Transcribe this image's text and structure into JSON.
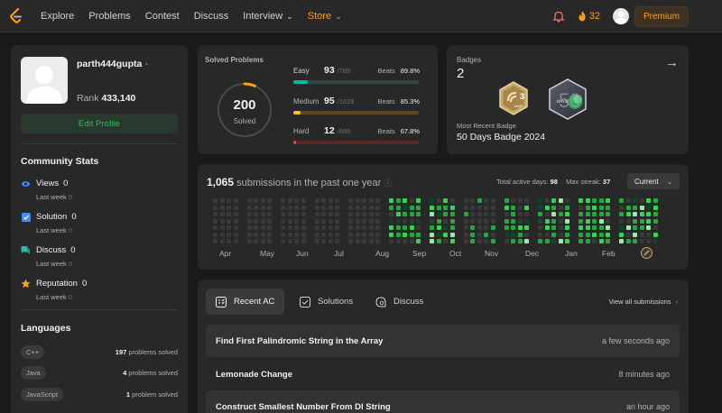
{
  "nav": {
    "links": [
      "Explore",
      "Problems",
      "Contest",
      "Discuss",
      "Interview",
      "Store"
    ],
    "streak": "32",
    "premium": "Premium"
  },
  "profile": {
    "username": "parth444gupta",
    "rank_label": "Rank",
    "rank_value": "433,140",
    "edit_label": "Edit Profile"
  },
  "community": {
    "title": "Community Stats",
    "items": [
      {
        "label": "Views",
        "value": "0",
        "sub": "Last week",
        "sub_value": "0"
      },
      {
        "label": "Solution",
        "value": "0",
        "sub": "Last week",
        "sub_value": "0"
      },
      {
        "label": "Discuss",
        "value": "0",
        "sub": "Last week",
        "sub_value": "0"
      },
      {
        "label": "Reputation",
        "value": "0",
        "sub": "Last week",
        "sub_value": "0"
      }
    ]
  },
  "languages": {
    "title": "Languages",
    "items": [
      {
        "name": "C++",
        "count": "197",
        "suffix": "problems solved"
      },
      {
        "name": "Java",
        "count": "4",
        "suffix": "problems solved"
      },
      {
        "name": "JavaScript",
        "count": "1",
        "suffix": "problem solved"
      }
    ]
  },
  "solved": {
    "title": "Solved Problems",
    "total": "200",
    "total_label": "Solved",
    "progress": 0.064,
    "beats_label": "Beats",
    "difficulties": [
      {
        "name": "Easy",
        "count": "93",
        "total": "/785",
        "beats": "89.8%",
        "fraction": 0.118,
        "color": "#00b8a3",
        "track": "#2a4a47"
      },
      {
        "name": "Medium",
        "count": "95",
        "total": "/1628",
        "beats": "85.3%",
        "fraction": 0.058,
        "color": "#ffc01e",
        "track": "#5a4a1f"
      },
      {
        "name": "Hard",
        "count": "12",
        "total": "/689",
        "beats": "67.8%",
        "fraction": 0.017,
        "color": "#ef4743",
        "track": "#5a2a2a"
      }
    ]
  },
  "badges": {
    "label": "Badges",
    "count": "2",
    "recent_label": "Most Recent Badge",
    "recent_name": "50 Days Badge 2024",
    "badge1_text": "MAR",
    "badge1_num": "3",
    "badge2_text": "DAYS",
    "badge2_num": "50"
  },
  "submissions": {
    "count": "1,065",
    "title_suffix": "submissions in the past one year",
    "active_label": "Total active days:",
    "active_value": "98",
    "streak_label": "Max streak:",
    "streak_value": "37",
    "filter": "Current",
    "months": [
      "Apr",
      "May",
      "Jun",
      "Jul",
      "Aug",
      "Sep",
      "Oct",
      "Nov",
      "Dec",
      "Jan",
      "Feb"
    ]
  },
  "recent": {
    "tabs": [
      "Recent AC",
      "Solutions",
      "Discuss"
    ],
    "view_all": "View all submissions",
    "items": [
      {
        "title": "Find First Palindromic String in the Array",
        "time": "a few seconds ago"
      },
      {
        "title": "Lemonade Change",
        "time": "8 minutes ago"
      },
      {
        "title": "Construct Smallest Number From DI String",
        "time": "an hour ago"
      }
    ]
  }
}
